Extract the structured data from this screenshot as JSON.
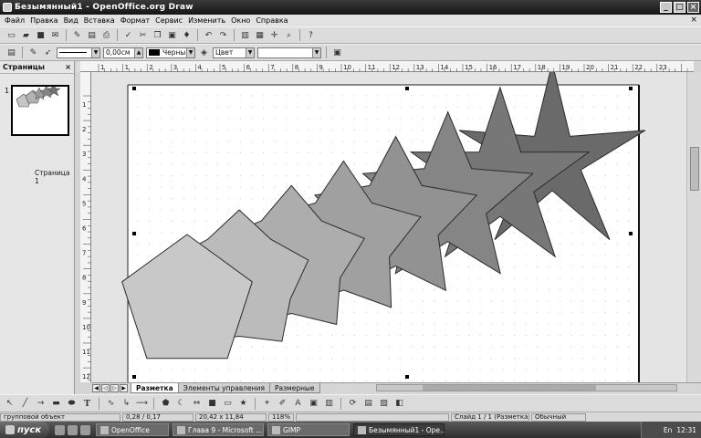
{
  "window": {
    "title": "Безымянный1 - OpenOffice.org Draw",
    "buttons": [
      "_",
      "□",
      "×"
    ]
  },
  "menu": [
    "Файл",
    "Правка",
    "Вид",
    "Вставка",
    "Формат",
    "Сервис",
    "Изменить",
    "Окно",
    "Справка"
  ],
  "doc_close": "×",
  "format_bar": {
    "line_width": "0,00см",
    "line_color": "Черный",
    "area_style": "Цвет",
    "area_value": ""
  },
  "pages_panel": {
    "title": "Страницы",
    "close": "×",
    "slide_number": "1",
    "thumb_label": "Страница 1"
  },
  "ruler": {
    "h_labels": [
      "1",
      "1",
      "2",
      "3",
      "4",
      "5",
      "6",
      "7",
      "8",
      "9",
      "10",
      "11",
      "12",
      "13",
      "14",
      "15",
      "16",
      "17",
      "18",
      "19",
      "20",
      "21",
      "22",
      "23"
    ],
    "v_labels": [
      "1",
      "2",
      "3",
      "4",
      "5",
      "6",
      "7",
      "8",
      "9",
      "10",
      "11",
      "12"
    ]
  },
  "tabs": {
    "items": [
      "Разметка",
      "Элементы управления",
      "Размерные"
    ],
    "active": "Разметка"
  },
  "status": {
    "selection": "групповой объект",
    "position": "0,28 / 0,17",
    "size": "20,42 x 11,84",
    "zoom": "118%",
    "slide": "Слайд 1 / 1 (Разметка)",
    "style": "Обычный"
  },
  "taskbar": {
    "start": "пуск",
    "items": [
      {
        "label": "OpenOffice",
        "active": false
      },
      {
        "label": "Глава 9 - Microsoft ...",
        "active": false
      },
      {
        "label": "GIMP",
        "active": false
      },
      {
        "label": "Безымянный1 - Ope...",
        "active": true
      }
    ],
    "lang": "En",
    "time": "12:31"
  },
  "colors": {
    "shape_light": "#c8c8c8",
    "shape_dark": "#6a6a6a",
    "page": "#ffffff",
    "canvas": "#e4e4e4"
  }
}
